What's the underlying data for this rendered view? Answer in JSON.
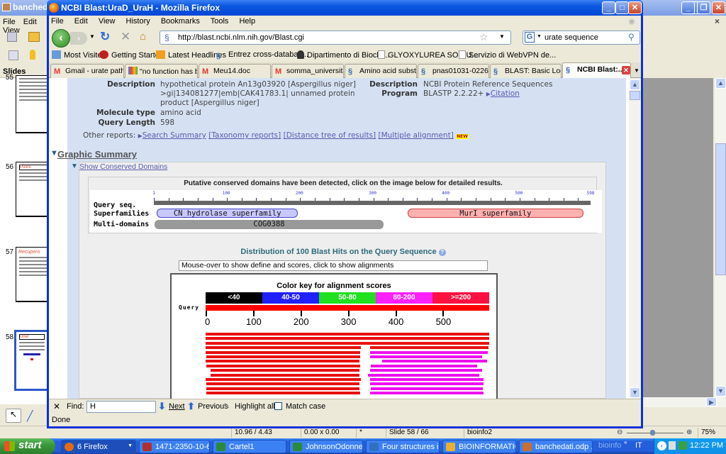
{
  "impress": {
    "title": "bancheda",
    "menu": [
      "File",
      "Edit",
      "View"
    ],
    "slides_header": "Slides",
    "slides": [
      {
        "num": "55",
        "title": ""
      },
      {
        "num": "56",
        "title": "Pulire"
      },
      {
        "num": "57",
        "title": "Recupero"
      },
      {
        "num": "58",
        "title": "Uber",
        "selected": true
      }
    ],
    "status": {
      "position": "10.96 / 4.43",
      "size": "0.00 x 0.00",
      "modified": "*",
      "slide": "Slide 58 / 66",
      "layout": "bioinfo2",
      "zoom": "75%",
      "zoom_fraction": 0.45
    },
    "close_doc": "×"
  },
  "firefox": {
    "title": "NCBI Blast:UraD_UraH - Mozilla Firefox",
    "menu": [
      "File",
      "Edit",
      "View",
      "History",
      "Bookmarks",
      "Tools",
      "Help"
    ],
    "url": "http://blast.ncbi.nlm.nih.gov/Blast.cgi",
    "search_value": "urate sequence",
    "bookmarks": [
      {
        "label": "Most Visited",
        "icon": "most-visited-icon"
      },
      {
        "label": "Getting Started",
        "icon": "firefox-icon"
      },
      {
        "label": "Latest Headlines",
        "icon": "rss-icon"
      },
      {
        "label": "Entrez cross-databas...",
        "icon": "ncbi-icon"
      },
      {
        "label": "Dipartimento di Biochi...",
        "icon": "linux-icon"
      },
      {
        "label": "GLYOXYLUREA SODIU...",
        "icon": "page-icon"
      },
      {
        "label": "Servizio di WebVPN de...",
        "icon": "page-icon"
      }
    ],
    "tabs": [
      {
        "label": "Gmail - urate path...",
        "icon": "gmail-icon"
      },
      {
        "label": "\"no function has b...",
        "icon": "google-icon"
      },
      {
        "label": "Meu14.doc",
        "icon": "gmail-icon"
      },
      {
        "label": "somma_universita...",
        "icon": "gmail-icon"
      },
      {
        "label": "Amino acid substit...",
        "icon": "ncbi-icon"
      },
      {
        "label": "pnas01031-0226....",
        "icon": "ncbi-icon"
      },
      {
        "label": "BLAST: Basic Loca...",
        "icon": "ncbi-icon"
      },
      {
        "label": "NCBI Blast:...",
        "icon": "ncbi-icon",
        "active": true
      }
    ],
    "find": {
      "label": "Find:",
      "value": "H",
      "next": "Next",
      "previous": "Previous",
      "highlight": "Highlight all",
      "match_case": "Match case"
    },
    "status": "Done"
  },
  "blast": {
    "left": {
      "description_label": "Description",
      "description_lines": [
        "hypothetical protein An13g03920 [Aspergillus niger]",
        ">gi|134081277|emb|CAK41783.1| unnamed protein",
        "product [Aspergillus niger]"
      ],
      "molecule_label": "Molecule type",
      "molecule_value": "amino acid",
      "length_label": "Query Length",
      "length_value": "598"
    },
    "right": {
      "description_label": "Description",
      "description_value": "NCBI Protein Reference Sequences",
      "program_label": "Program",
      "program_value": "BLASTP 2.2.22+",
      "citation": "Citation"
    },
    "other_reports_label": "Other reports:",
    "other_reports": [
      "Search Summary",
      "[Taxonomy reports]",
      "[Distance tree of results]",
      "[Multiple alignment]"
    ],
    "new_badge": "NEW",
    "graphic_summary": "Graphic Summary",
    "show_conserved": "Show Conserved Domains",
    "putative": "Putative conserved domains have been detected, click on the image below for detailed results.",
    "domains": {
      "query_length": 598,
      "ticks": [
        1,
        100,
        200,
        300,
        400,
        500,
        598
      ],
      "row_labels": [
        "Query seq.",
        "Superfamilies",
        "Multi-domains"
      ],
      "items": [
        {
          "name": "CN_hydrolase superfamily",
          "row": 1,
          "start": 5,
          "end": 198,
          "color": "#c8c8ff"
        },
        {
          "name": "MurI superfamily",
          "row": 1,
          "start": 348,
          "end": 588,
          "color": "#ffb0b0"
        },
        {
          "name": "COG0388",
          "row": 2,
          "start": 2,
          "end": 315,
          "color": "#999999"
        }
      ]
    },
    "distribution_title": "Distribution of 100 Blast Hits on the Query Sequence",
    "mouseover_text": "Mouse-over to show define and scores, click to show alignments",
    "color_key_title": "Color key for alignment scores",
    "color_key": [
      {
        "label": "<40",
        "color": "#000000",
        "text": "#ffffff"
      },
      {
        "label": "40-50",
        "color": "#2020ff",
        "text": "#ffffff"
      },
      {
        "label": "50-80",
        "color": "#20e020",
        "text": "#ffffff"
      },
      {
        "label": "80-200",
        "color": "#ff20ff",
        "text": "#ffffff"
      },
      {
        "label": ">=200",
        "color": "#ff1040",
        "text": "#ffffff"
      }
    ],
    "query_label": "Query",
    "axis_ticks": [
      0,
      100,
      200,
      300,
      400,
      500
    ],
    "hits": [
      [
        {
          "s": 0,
          "e": 598,
          "c": "#e81010"
        }
      ],
      [
        {
          "s": 0,
          "e": 598,
          "c": "#e81010"
        }
      ],
      [
        {
          "s": 0,
          "e": 598,
          "c": "#e81010"
        }
      ],
      [
        {
          "s": 0,
          "e": 327,
          "c": "#e81010"
        },
        {
          "s": 347,
          "e": 597,
          "c": "#e81010"
        }
      ],
      [
        {
          "s": 0,
          "e": 326,
          "c": "#e81010"
        },
        {
          "s": 347,
          "e": 595,
          "c": "#ee10ee"
        }
      ],
      [
        {
          "s": 2,
          "e": 326,
          "c": "#e81010"
        },
        {
          "s": 347,
          "e": 583,
          "c": "#ee10ee"
        }
      ],
      [
        {
          "s": 0,
          "e": 325,
          "c": "#e81010"
        },
        {
          "s": 373,
          "e": 594,
          "c": "#ee10ee"
        }
      ],
      [
        {
          "s": 2,
          "e": 326,
          "c": "#e81010"
        },
        {
          "s": 348,
          "e": 573,
          "c": "#ee10ee"
        }
      ],
      [
        {
          "s": 11,
          "e": 325,
          "c": "#e81010"
        },
        {
          "s": 347,
          "e": 583,
          "c": "#ee10ee"
        }
      ],
      [
        {
          "s": 11,
          "e": 325,
          "c": "#e81010"
        },
        {
          "s": 343,
          "e": 577,
          "c": "#ee10ee"
        }
      ],
      [
        {
          "s": 0,
          "e": 327,
          "c": "#e81010"
        },
        {
          "s": 347,
          "e": 586,
          "c": "#ee10ee"
        }
      ],
      [
        {
          "s": 2,
          "e": 325,
          "c": "#e81010"
        },
        {
          "s": 347,
          "e": 586,
          "c": "#ee10ee"
        }
      ],
      [
        {
          "s": 2,
          "e": 325,
          "c": "#e81010"
        },
        {
          "s": 348,
          "e": 584,
          "c": "#ee10ee"
        }
      ],
      [
        {
          "s": 2,
          "e": 326,
          "c": "#e81010"
        },
        {
          "s": 347,
          "e": 586,
          "c": "#ee10ee"
        }
      ]
    ]
  },
  "taskbar": {
    "start": "start",
    "items": [
      {
        "label": "6 Firefox",
        "color": "#e86a10"
      },
      {
        "label": "1471-2350-10-6...",
        "color": "#b03030"
      },
      {
        "label": "Cartel1",
        "color": "#2a8a3a"
      },
      {
        "label": "JohnsonOdonne...",
        "color": "#2a8a3a"
      },
      {
        "label": "Four structures i...",
        "color": "#3070c0"
      },
      {
        "label": "BIOINFORMATICA",
        "color": "#e8b030"
      },
      {
        "label": "banchedati.odp ...",
        "color": "#c87030"
      }
    ],
    "extra": "bioinfo",
    "lang": "IT",
    "clock": "12:22 PM"
  }
}
